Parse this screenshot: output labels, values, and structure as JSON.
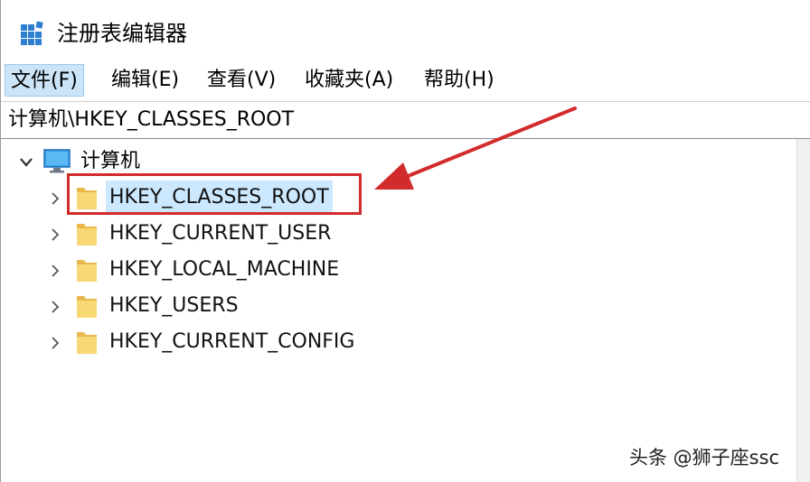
{
  "window": {
    "title": "注册表编辑器",
    "icon": "registry-editor-icon"
  },
  "menu": {
    "items": [
      {
        "label": "文件(F)",
        "active": true
      },
      {
        "label": "编辑(E)",
        "active": false
      },
      {
        "label": "查看(V)",
        "active": false
      },
      {
        "label": "收藏夹(A)",
        "active": false
      },
      {
        "label": "帮助(H)",
        "active": false
      }
    ]
  },
  "address": {
    "path": "计算机\\HKEY_CLASSES_ROOT"
  },
  "tree": {
    "root": {
      "label": "计算机",
      "expanded": true,
      "icon": "computer-icon"
    },
    "nodes": [
      {
        "label": "HKEY_CLASSES_ROOT",
        "selected": true
      },
      {
        "label": "HKEY_CURRENT_USER",
        "selected": false
      },
      {
        "label": "HKEY_LOCAL_MACHINE",
        "selected": false
      },
      {
        "label": "HKEY_USERS",
        "selected": false
      },
      {
        "label": "HKEY_CURRENT_CONFIG",
        "selected": false
      }
    ]
  },
  "annotation": {
    "highlight_color": "#d22b2b",
    "arrow_color": "#d22b2b"
  },
  "watermark": {
    "text": "头条 @狮子座ssc"
  },
  "colors": {
    "selection": "#cce8ff",
    "menu_active": "#cce4f7",
    "folder": "#f8d775"
  }
}
